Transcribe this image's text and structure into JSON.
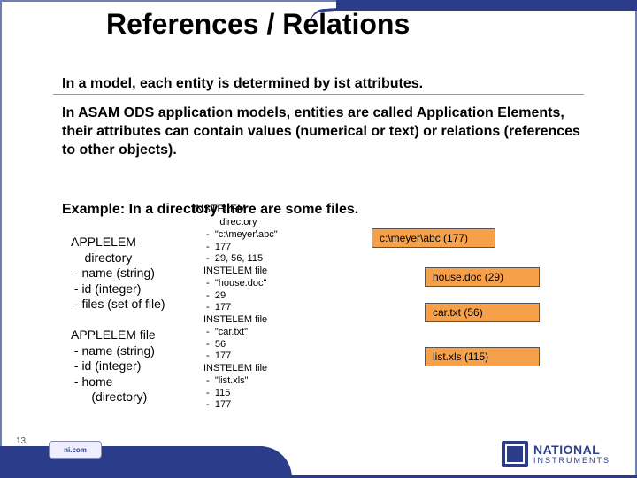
{
  "title": "References / Relations",
  "line1": "In a model, each entity is determined by ist attributes.",
  "para": "In ASAM ODS application models, entities are called Application Elements, their attributes can contain values (numerical or text) or relations (references to other objects).",
  "example": "Example: In a directory there are some files.",
  "instelem_label": "INSTELEM",
  "col1": "APPLELEM\n    directory\n - name (string)\n - id (integer)\n - files (set of file)\n\nAPPLELEM file\n - name (string)\n - id (integer)\n - home\n      (directory)",
  "col2": "      directory\n -  \"c:\\meyer\\abc\"\n -  177\n -  29, 56, 115\nINSTELEM file\n -  \"house.doc\"\n -  29\n -  177\nINSTELEM file\n -  \"car.txt\"\n -  56\n -  177\nINSTELEM file\n -  \"list.xls\"\n -  115\n -  177",
  "boxes": {
    "dir": "c:\\meyer\\abc (177)",
    "f1": "house.doc (29)",
    "f2": "car.txt (56)",
    "f3": "list.xls (115)"
  },
  "page_num": "13",
  "footer": {
    "left": "ni.com",
    "brand": "NATIONAL",
    "sub": "INSTRUMENTS"
  }
}
